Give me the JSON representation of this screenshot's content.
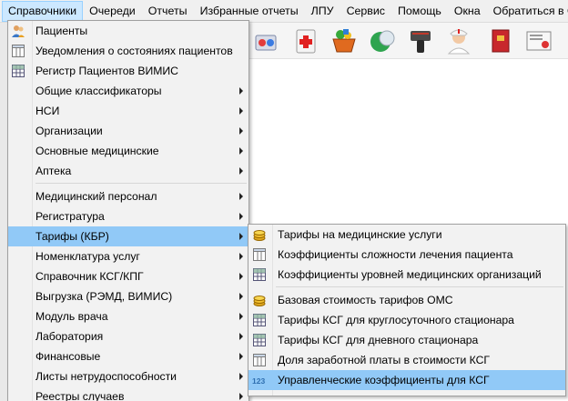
{
  "menubar": {
    "items": [
      "Справочники",
      "Очереди",
      "Отчеты",
      "Избранные отчеты",
      "ЛПУ",
      "Сервис",
      "Помощь",
      "Окна",
      "Обратиться в ОС"
    ],
    "active_index": 0
  },
  "main_menu": {
    "items": [
      {
        "label": "Пациенты",
        "icon": "patients-icon",
        "submenu": false
      },
      {
        "label": "Уведомления о состояниях пациентов",
        "icon": "table-icon",
        "submenu": false
      },
      {
        "label": "Регистр Пациентов ВИМИС",
        "icon": "grid-icon",
        "submenu": false
      },
      {
        "label": "Общие классификаторы",
        "icon": "",
        "submenu": true
      },
      {
        "label": "НСИ",
        "icon": "",
        "submenu": true
      },
      {
        "label": "Организации",
        "icon": "",
        "submenu": true
      },
      {
        "label": "Основные медицинские",
        "icon": "",
        "submenu": true
      },
      {
        "label": "Аптека",
        "icon": "",
        "submenu": true
      },
      {
        "label": "Медицинский персонал",
        "icon": "",
        "submenu": true
      },
      {
        "label": "Регистратура",
        "icon": "",
        "submenu": true
      },
      {
        "label": "Тарифы (КБР)",
        "icon": "",
        "submenu": true
      },
      {
        "label": "Номенклатура услуг",
        "icon": "",
        "submenu": true
      },
      {
        "label": "Справочник КСГ/КПГ",
        "icon": "",
        "submenu": true
      },
      {
        "label": "Выгрузка (РЭМД, ВИМИС)",
        "icon": "",
        "submenu": true
      },
      {
        "label": "Модуль врача",
        "icon": "",
        "submenu": true
      },
      {
        "label": "Лаборатория",
        "icon": "",
        "submenu": true
      },
      {
        "label": "Финансовые",
        "icon": "",
        "submenu": true
      },
      {
        "label": "Листы нетрудоспособности",
        "icon": "",
        "submenu": true
      },
      {
        "label": "Реестры случаев",
        "icon": "",
        "submenu": true
      }
    ]
  },
  "sub_menu": {
    "items": [
      {
        "label": "Тарифы на медицинские услуги",
        "icon": "coins-icon"
      },
      {
        "label": "Коэффициенты сложности лечения пациента",
        "icon": "table-icon"
      },
      {
        "label": "Коэффициенты уровней медицинских организаций",
        "icon": "grid-icon"
      },
      {
        "label": "Базовая стоимость тарифов ОМС",
        "icon": "coins-icon"
      },
      {
        "label": "Тарифы КСГ для круглосуточного стационара",
        "icon": "grid-icon"
      },
      {
        "label": "Тарифы КСГ для дневного стационара",
        "icon": "grid-icon"
      },
      {
        "label": "Доля заработной платы в стоимости КСГ",
        "icon": "table-icon"
      },
      {
        "label": "Управленческие коэффициенты для КСГ",
        "icon": "numbers-icon"
      }
    ],
    "icon_text": "123"
  },
  "colors": {
    "menu_bg": "#f2f2f2",
    "highlight": "#91c9f7",
    "menubar_active": "#cce8ff"
  }
}
